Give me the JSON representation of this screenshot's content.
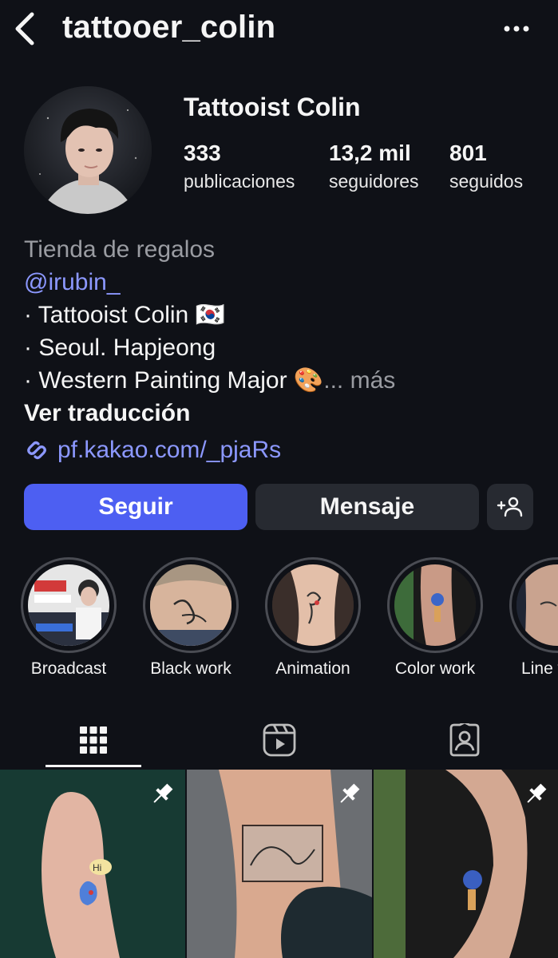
{
  "header": {
    "username": "tattooer_colin"
  },
  "profile": {
    "display_name": "Tattooist Colin",
    "stats": [
      {
        "value": "333",
        "label": "publicaciones"
      },
      {
        "value": "13,2 mil",
        "label": "seguidores"
      },
      {
        "value": "801",
        "label": "seguidos"
      }
    ]
  },
  "bio": {
    "category": "Tienda de regalos",
    "mention": "@irubin_",
    "lines": [
      " · Tattooist Colin 🇰🇷",
      " · Seoul. Hapjeong",
      " · Western Painting Major 🎨"
    ],
    "more": "... más",
    "translate": "Ver traducción",
    "link": "pf.kakao.com/_pjaRs"
  },
  "actions": {
    "follow": "Seguir",
    "message": "Mensaje"
  },
  "highlights": [
    {
      "label": "Broadcast"
    },
    {
      "label": "Black work"
    },
    {
      "label": "Animation"
    },
    {
      "label": "Color work"
    },
    {
      "label": "Line work"
    }
  ],
  "icons": {
    "back": "chevron-left-icon",
    "more": "more-horizontal-icon",
    "link": "link-icon",
    "suggest": "add-person-icon",
    "grid": "grid-icon",
    "reels": "reels-icon",
    "tagged": "tagged-icon",
    "pin": "pin-icon"
  },
  "colors": {
    "background": "#0f1117",
    "accent": "#4d5ff2",
    "link": "#8c98ff"
  }
}
